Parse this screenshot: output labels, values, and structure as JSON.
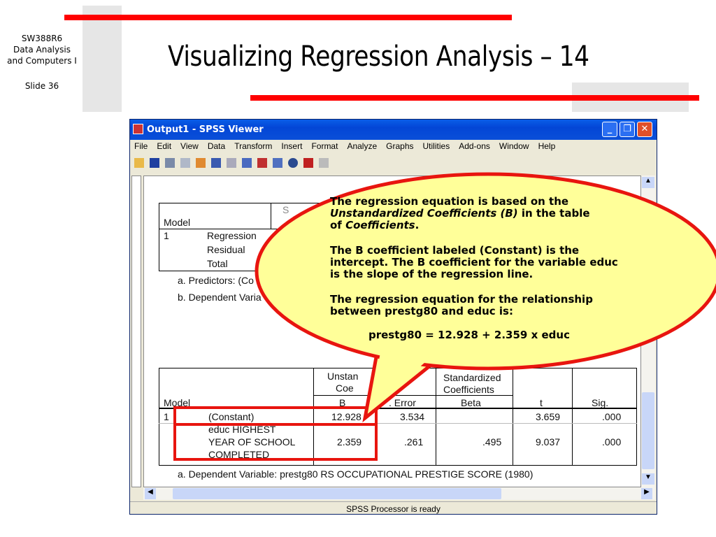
{
  "slide": {
    "course": "SW388R6",
    "line2": "Data Analysis",
    "line3": "and Computers I",
    "slide_no": "Slide 36",
    "title": "Visualizing Regression Analysis – 14"
  },
  "window": {
    "title": "Output1 - SPSS Viewer",
    "menu": [
      "File",
      "Edit",
      "View",
      "Data",
      "Transform",
      "Insert",
      "Format",
      "Analyze",
      "Graphs",
      "Utilities",
      "Add-ons",
      "Window",
      "Help"
    ],
    "status": "SPSS Processor is ready"
  },
  "anova": {
    "model": "Model",
    "col_partial": "S",
    "num": "1",
    "rows": [
      "Regression",
      "Residual",
      "Total"
    ],
    "note_a": "a. Predictors: (Co",
    "note_b": "b. Dependent Varia"
  },
  "coef": {
    "model": "Model",
    "h_unstd1": "Unstan",
    "h_unstd2": "Coe",
    "h_std1": "Standardized",
    "h_std2": "Coefficients",
    "h_b": "B",
    "h_se": ". Error",
    "h_beta": "Beta",
    "h_t": "t",
    "h_sig": "Sig.",
    "num": "1",
    "rows": [
      {
        "label": "(Constant)",
        "b": "12.928",
        "se": "3.534",
        "beta": "",
        "t": "3.659",
        "sig": ".000"
      },
      {
        "label1": "educ  HIGHEST",
        "label2": "YEAR OF SCHOOL",
        "label3": "COMPLETED",
        "b": "2.359",
        "se": ".261",
        "beta": ".495",
        "t": "9.037",
        "sig": ".000"
      }
    ],
    "note": "a. Dependent Variable: prestg80  RS OCCUPATIONAL PRESTIGE SCORE  (1980)"
  },
  "callout": {
    "p1a": "The regression equation is based on the",
    "p1b": "Unstandardized Coefficients (B)",
    "p1c": " in the table",
    "p1d": "of ",
    "p1e": "Coefficients",
    "p1f": ".",
    "p2": "The B coefficient labeled (Constant) is the intercept. The B coefficient for the variable educ is the slope of the regression line.",
    "p3": "The regression equation for the relationship between prestg80 and educ is:",
    "eq": "prestg80 = 12.928 + 2.359 x educ"
  }
}
